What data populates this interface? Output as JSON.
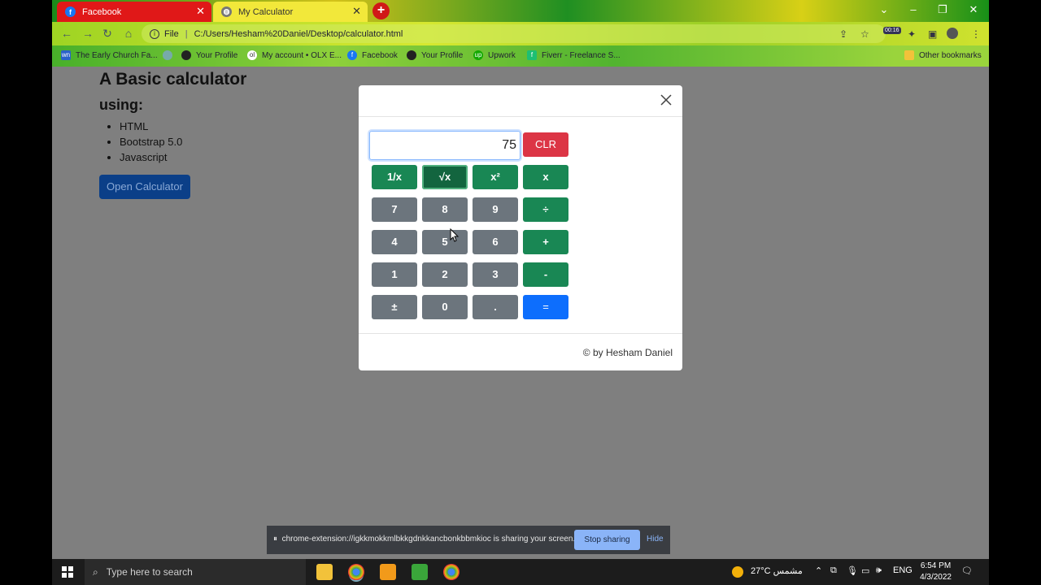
{
  "browser": {
    "tabs": [
      {
        "title": "Facebook"
      },
      {
        "title": "My Calculator"
      }
    ],
    "address": {
      "scheme": "File",
      "url": "C:/Users/Hesham%20Daniel/Desktop/calculator.html"
    },
    "extension_timer": "00:16",
    "bookmarks": [
      {
        "label": "The Early Church Fa..."
      },
      {
        "label": "Your Profile"
      },
      {
        "label": "My account • OLX E..."
      },
      {
        "label": "Facebook"
      },
      {
        "label": "Your Profile"
      },
      {
        "label": "Upwork"
      },
      {
        "label": "Fiverr - Freelance S..."
      }
    ],
    "other_bookmarks": "Other bookmarks"
  },
  "page": {
    "title": "A Basic calculator",
    "subtitle": "using:",
    "list": [
      "HTML",
      "Bootstrap 5.0",
      "Javascript"
    ],
    "open_button": "Open Calculator"
  },
  "calculator": {
    "display": "75",
    "clear": "CLR",
    "rows": [
      [
        "1/x",
        "√x",
        "x²",
        "x"
      ],
      [
        "7",
        "8",
        "9",
        "÷"
      ],
      [
        "4",
        "5",
        "6",
        "+"
      ],
      [
        "1",
        "2",
        "3",
        "-"
      ],
      [
        "±",
        "0",
        ".",
        "="
      ]
    ],
    "footer": "© by Hesham Daniel"
  },
  "share_bar": {
    "message": "chrome-extension://igkkmokkmlbkkgdnkkancbonkbbmkioc is sharing your screen.",
    "stop": "Stop sharing",
    "hide": "Hide"
  },
  "taskbar": {
    "search_placeholder": "Type here to search",
    "weather": "27°C  مشمس",
    "language": "ENG",
    "time": "6:54 PM",
    "date": "4/3/2022"
  }
}
